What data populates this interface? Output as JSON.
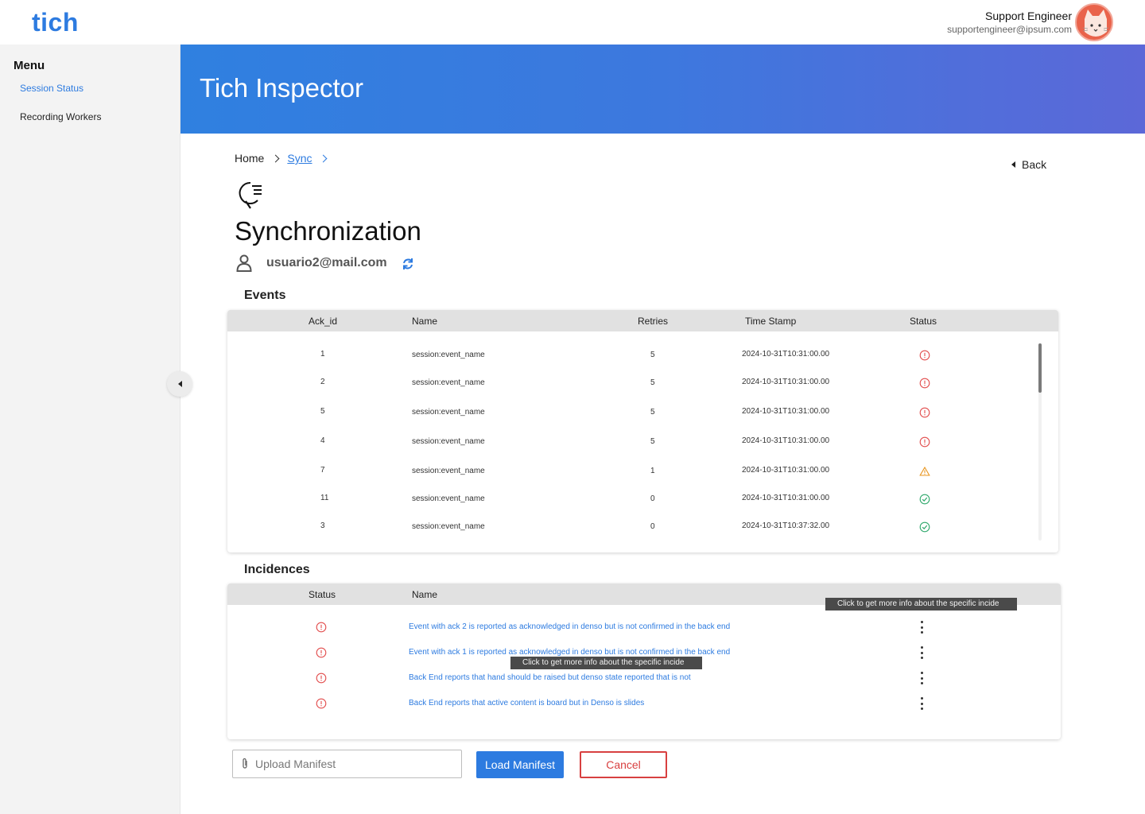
{
  "app": {
    "logo": "tich"
  },
  "user": {
    "name": "Support Engineer",
    "email": "supportengineer@ipsum.com"
  },
  "sidebar": {
    "title": "Menu",
    "items": [
      {
        "label": "Session Status",
        "active": true
      },
      {
        "label": "Recording Workers",
        "active": false
      }
    ]
  },
  "banner": {
    "title": "Tich Inspector"
  },
  "breadcrumb": {
    "home": "Home",
    "current": "Sync"
  },
  "back": {
    "label": "Back"
  },
  "page": {
    "title": "Synchronization",
    "session_email": "usuario2@mail.com"
  },
  "events": {
    "title": "Events",
    "headers": {
      "ack_id": "Ack_id",
      "name": "Name",
      "retries": "Retries",
      "timestamp": "Time Stamp",
      "status": "Status"
    },
    "rows": [
      {
        "ack_id": "1",
        "name": "session:event_name",
        "retries": "5",
        "timestamp": "2024-10-31T10:31:00.00",
        "status": "error"
      },
      {
        "ack_id": "2",
        "name": "session:event_name",
        "retries": "5",
        "timestamp": "2024-10-31T10:31:00.00",
        "status": "error"
      },
      {
        "ack_id": "5",
        "name": "session:event_name",
        "retries": "5",
        "timestamp": "2024-10-31T10:31:00.00",
        "status": "error"
      },
      {
        "ack_id": "4",
        "name": "session:event_name",
        "retries": "5",
        "timestamp": "2024-10-31T10:31:00.00",
        "status": "error"
      },
      {
        "ack_id": "7",
        "name": "session:event_name",
        "retries": "1",
        "timestamp": "2024-10-31T10:31:00.00",
        "status": "warning"
      },
      {
        "ack_id": "11",
        "name": "session:event_name",
        "retries": "0",
        "timestamp": "2024-10-31T10:31:00.00",
        "status": "ok"
      },
      {
        "ack_id": "3",
        "name": "session:event_name",
        "retries": "0",
        "timestamp": "2024-10-31T10:37:32.00",
        "status": "ok"
      }
    ]
  },
  "incidences": {
    "title": "Incidences",
    "headers": {
      "status": "Status",
      "name": "Name"
    },
    "rows": [
      {
        "status": "error",
        "name": "Event with ack 2 is reported as acknowledged in denso but is not confirmed in the back end"
      },
      {
        "status": "error",
        "name": "Event with ack 1 is reported as acknowledged in denso but is not confirmed in the back end"
      },
      {
        "status": "error",
        "name": "Back End reports that hand should be raised but denso state reported that is not"
      },
      {
        "status": "error",
        "name": "Back End reports that active content is board but in Denso is slides"
      }
    ],
    "tooltip": "Click  to get more info about the specific incide",
    "tooltip_name": "Click  to get more info about the specific incide"
  },
  "footer": {
    "upload_placeholder": "Upload Manifest",
    "load_label": "Load Manifest",
    "cancel_label": "Cancel"
  },
  "colors": {
    "accent": "#2d7be0",
    "error": "#e24c4c",
    "warning": "#e8951e",
    "ok": "#2ea86b",
    "cancel": "#d84040"
  }
}
